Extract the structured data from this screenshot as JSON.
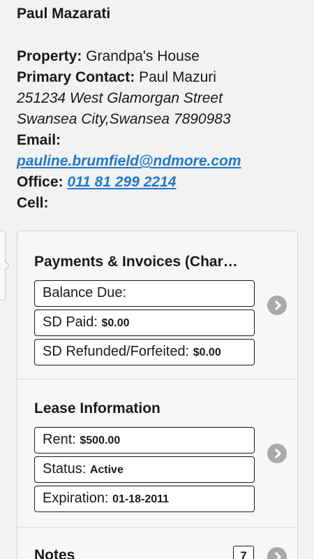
{
  "contact": {
    "name": "Paul Mazarati",
    "property_label": "Property:",
    "property_value": "Grandpa's House",
    "primary_contact_label": "Primary Contact:",
    "primary_contact_value": "Paul Mazuri",
    "address_line1": "251234 West Glamorgan Street",
    "address_line2": "Swansea City,Swansea 7890983",
    "email_label": "Email:",
    "email_value": "pauline.brumfield@ndmore.com",
    "office_label": "Office:",
    "office_value": "011 81 299 2214",
    "cell_label": "Cell:"
  },
  "payments": {
    "title": "Payments & Invoices (Char…",
    "balance_label": "Balance Due:",
    "sd_paid_label": "SD Paid:",
    "sd_paid_value": "$0.00",
    "sd_refunded_label": "SD Refunded/Forfeited:",
    "sd_refunded_value": "$0.00"
  },
  "lease": {
    "title": "Lease Information",
    "rent_label": "Rent:",
    "rent_value": "$500.00",
    "status_label": "Status:",
    "status_value": "Active",
    "expiration_label": "Expiration:",
    "expiration_value": "01-18-2011"
  },
  "notes": {
    "title": "Notes",
    "count": "7"
  },
  "icons": {
    "chevron": "chevron-right-icon",
    "side_tab": "sidebar-handle"
  }
}
